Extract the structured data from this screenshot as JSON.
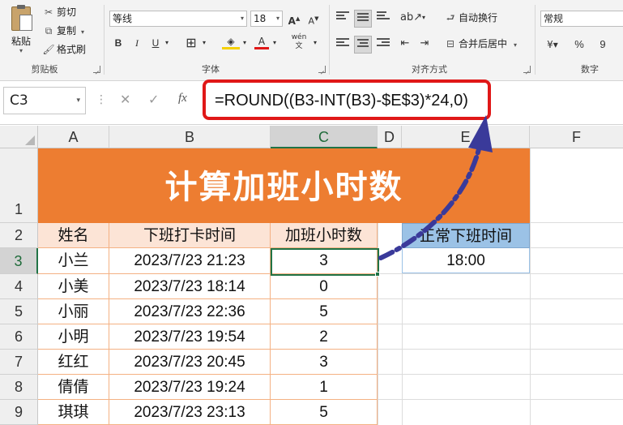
{
  "ribbon": {
    "clipboard": {
      "paste": "粘贴",
      "cut": "剪切",
      "copy": "复制",
      "format_painter": "格式刷",
      "label": "剪贴板"
    },
    "font": {
      "font_name": "等线",
      "font_size": "18",
      "bold": "B",
      "italic": "I",
      "underline": "U",
      "label": "字体"
    },
    "alignment": {
      "wrap_text": "自动换行",
      "merge_center": "合并后居中",
      "label": "对齐方式"
    },
    "number": {
      "format": "常规",
      "percent": "%",
      "comma": "9",
      "label": "数字"
    }
  },
  "formula_bar": {
    "name_box": "C3",
    "fx": "fx",
    "formula": "=ROUND((B3-INT(B3)-$E$3)*24,0)"
  },
  "columns": [
    "A",
    "B",
    "C",
    "D",
    "E",
    "F"
  ],
  "rows": [
    "1",
    "2",
    "3",
    "4",
    "5",
    "6",
    "7",
    "8",
    "9"
  ],
  "sheet": {
    "title": "计算加班小时数",
    "headers": [
      "姓名",
      "下班打卡时间",
      "加班小时数"
    ],
    "records": [
      {
        "name": "小兰",
        "time": "2023/7/23 21:23",
        "hours": "3"
      },
      {
        "name": "小美",
        "time": "2023/7/23 18:14",
        "hours": "0"
      },
      {
        "name": "小丽",
        "time": "2023/7/23 22:36",
        "hours": "5"
      },
      {
        "name": "小明",
        "time": "2023/7/23 19:54",
        "hours": "2"
      },
      {
        "name": "红红",
        "time": "2023/7/23 20:45",
        "hours": "3"
      },
      {
        "name": "倩倩",
        "time": "2023/7/23 19:24",
        "hours": "1"
      },
      {
        "name": "琪琪",
        "time": "2023/7/23 23:13",
        "hours": "5"
      }
    ],
    "standard_header": "正常下班时间",
    "standard_value": "18:00"
  },
  "colors": {
    "title_bg": "#ED7D31",
    "header_bg": "#FCE4D6",
    "blue_header_bg": "#9BC2E6",
    "highlight_border": "#E01818",
    "arrow": "#3A3A9A",
    "selection": "#217346"
  }
}
